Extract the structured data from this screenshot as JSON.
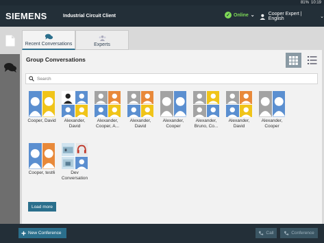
{
  "status": {
    "battery": "81%",
    "time": "10:19"
  },
  "header": {
    "brand": "SIEMENS",
    "app_title": "Industrial Circuit Client",
    "presence": "Online",
    "user_label": "Cooper Expert | English"
  },
  "tabs": [
    {
      "label": "Recent Conversations",
      "active": true
    },
    {
      "label": "Experts",
      "active": false
    }
  ],
  "panel": {
    "title": "Group Conversations",
    "search_placeholder": "Search"
  },
  "conversations": [
    {
      "name": "Cooper, David"
    },
    {
      "name_line1": "Alexander,",
      "name_line2": "David"
    },
    {
      "name_line1": "Alexander,",
      "name_line2": "Cooper, A..."
    },
    {
      "name_line1": "Alexander,",
      "name_line2": "David"
    },
    {
      "name_line1": "Alexander,",
      "name_line2": "Cooper"
    },
    {
      "name_line1": "Alexander,",
      "name_line2": "Bruno, Co..."
    },
    {
      "name_line1": "Alexander,",
      "name_line2": "David"
    },
    {
      "name_line1": "Alexander,",
      "name_line2": "Cooper"
    },
    {
      "name": "Cooper, test6"
    },
    {
      "name_line1": "Dev",
      "name_line2": "Conversation"
    }
  ],
  "load_more_label": "Load more",
  "bottom": {
    "new_conference": "New Conference",
    "call": "Call",
    "conference": "Conference"
  },
  "colors": {
    "accent": "#2b6f8c",
    "header_bg": "#232f38",
    "online": "#7ed957",
    "avatar_blue": "#5b8fd0",
    "avatar_yellow": "#f0c419",
    "avatar_orange": "#e8893a",
    "avatar_gray": "#a3a3a3"
  }
}
